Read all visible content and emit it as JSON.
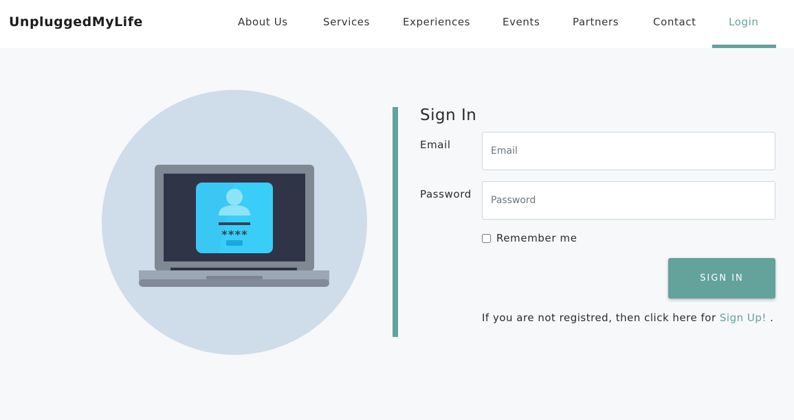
{
  "brand": "UnpluggedMyLife",
  "nav": {
    "items": [
      "About Us",
      "Services",
      "Experiences",
      "Events",
      "Partners",
      "Contact",
      "Login"
    ],
    "active": "Login"
  },
  "form": {
    "title": "Sign In",
    "email_label": "Email",
    "email_placeholder": "Email",
    "password_label": "Password",
    "password_placeholder": "Password",
    "remember_label": "Remember me",
    "submit_label": "SIGN IN",
    "register_prefix": "If you are not registred, then click here for",
    "register_link": "Sign Up!",
    "register_suffix": "."
  },
  "illustration": {
    "icon": "laptop-login-icon",
    "password_mask": "****"
  },
  "colors": {
    "accent": "#64a29c",
    "background": "#f6f8f9",
    "illustration_circle": "#cfdce9"
  }
}
